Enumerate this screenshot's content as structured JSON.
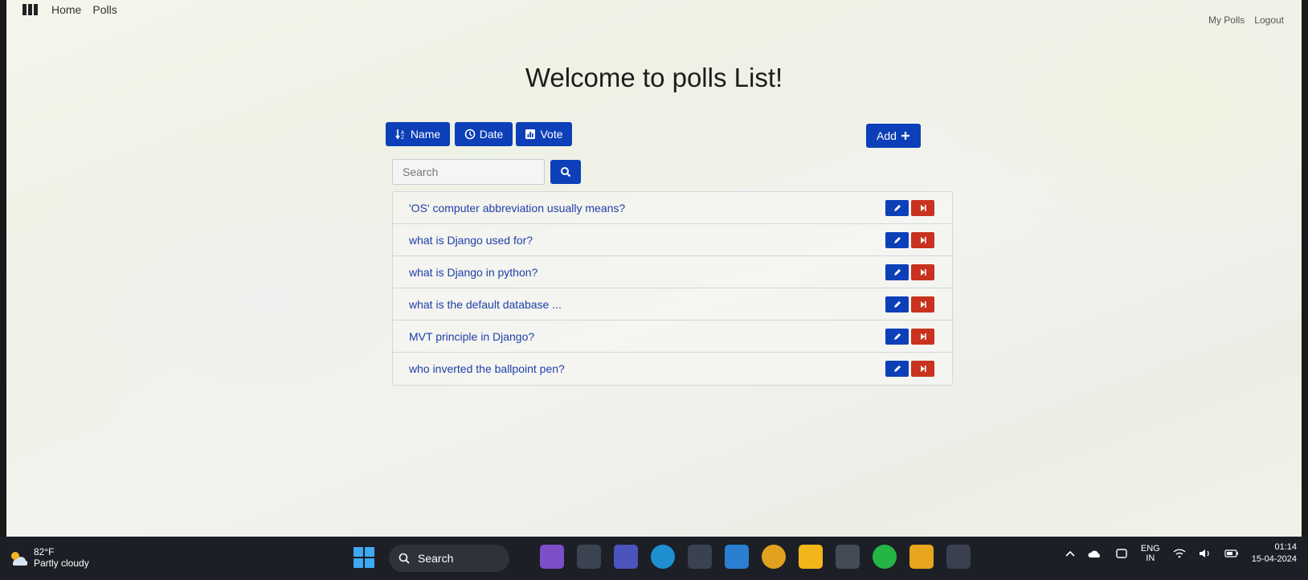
{
  "nav": {
    "home": "Home",
    "polls": "Polls",
    "my_polls": "My Polls",
    "logout": "Logout"
  },
  "page": {
    "title": "Welcome to polls List!"
  },
  "sort_buttons": {
    "name": "Name",
    "date": "Date",
    "vote": "Vote"
  },
  "add_button": "Add",
  "search": {
    "placeholder": "Search"
  },
  "polls": [
    {
      "question": "'OS' computer abbreviation usually means?"
    },
    {
      "question": "what is Django used for?"
    },
    {
      "question": "what is Django in python?"
    },
    {
      "question": "what is the default database ..."
    },
    {
      "question": "MVT principle in Django?"
    },
    {
      "question": "who inverted the ballpoint pen?"
    }
  ],
  "taskbar": {
    "weather_temp": "82°F",
    "weather_desc": "Partly cloudy",
    "search_label": "Search",
    "lang_top": "ENG",
    "lang_bottom": "IN",
    "time": "01:14",
    "date": "15-04-2024"
  },
  "colors": {
    "primary": "#0d3fb8",
    "danger": "#c8321e",
    "link": "#1e3fa8"
  }
}
